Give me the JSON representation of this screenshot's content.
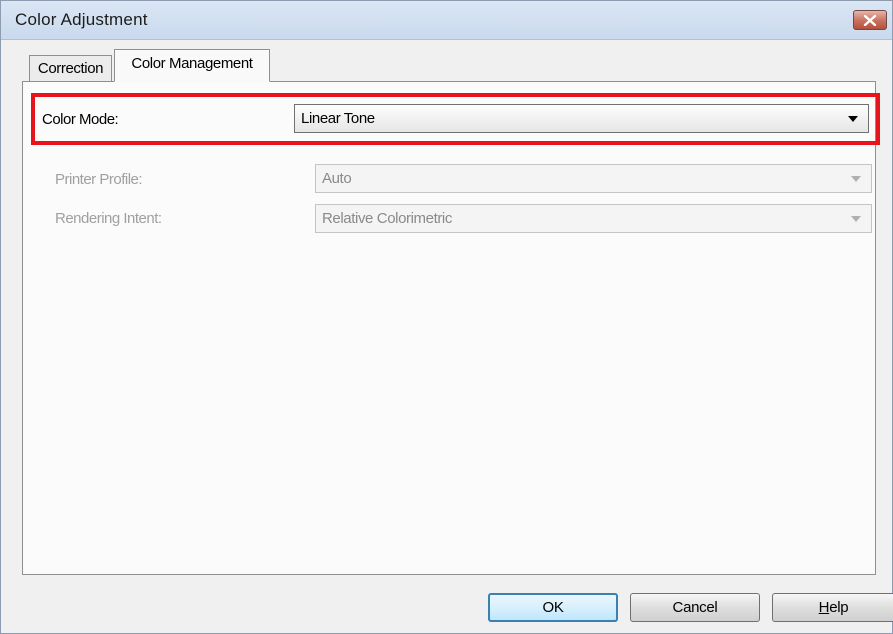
{
  "window": {
    "title": "Color Adjustment",
    "close_icon": "close-icon"
  },
  "tabs": [
    {
      "label": "Correction",
      "selected": false
    },
    {
      "label": "Color Management",
      "selected": true
    }
  ],
  "color_mode": {
    "label": "Color Mode:",
    "value": "Linear Tone",
    "enabled": true,
    "highlight_color": "#e8141c"
  },
  "printer_profile": {
    "label": "Printer Profile:",
    "value": "Auto",
    "enabled": false
  },
  "rendering_intent": {
    "label": "Rendering Intent:",
    "value": "Relative Colorimetric",
    "enabled": false
  },
  "buttons": {
    "ok": "OK",
    "cancel": "Cancel",
    "help_first": "H",
    "help_rest": "elp"
  }
}
